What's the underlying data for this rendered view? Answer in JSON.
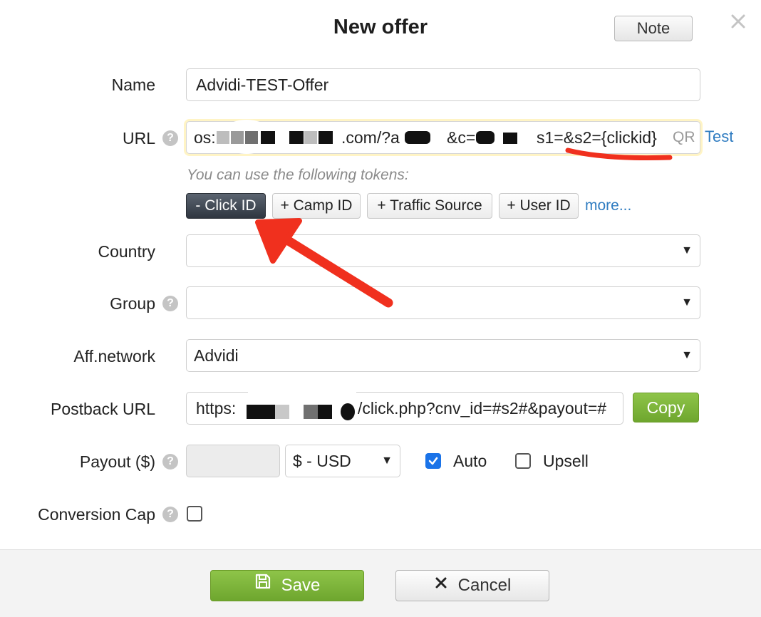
{
  "dialog": {
    "title": "New offer",
    "note_label": "Note",
    "close_icon": "close-icon"
  },
  "form": {
    "name": {
      "label": "Name",
      "value": "Advidi-TEST-Offer"
    },
    "url": {
      "label": "URL",
      "value_prefix": "os:",
      "value_mid1": ".com/?a",
      "value_mid2": "&c=",
      "value_suffix": "s1=&s2={clickid}",
      "qr_label": "QR",
      "test_label": "Test"
    },
    "tokens": {
      "hint": "You can use the following tokens:",
      "items": [
        "-  Click ID",
        "+ Camp ID",
        "+ Traffic Source",
        "+ User ID"
      ],
      "active_index": 0,
      "more_label": "more..."
    },
    "country": {
      "label": "Country",
      "value": ""
    },
    "group": {
      "label": "Group",
      "value": ""
    },
    "aff_network": {
      "label": "Aff.network",
      "value": "Advidi"
    },
    "postback": {
      "label": "Postback URL",
      "value_prefix": "https:",
      "value_suffix": "/click.php?cnv_id=#s2#&payout=#",
      "copy_label": "Copy"
    },
    "payout": {
      "label": "Payout ($)",
      "amount": "",
      "currency": "$ - USD",
      "auto_label": "Auto",
      "auto_checked": true,
      "upsell_label": "Upsell",
      "upsell_checked": false
    },
    "conversion_cap": {
      "label": "Conversion Cap",
      "checked": false
    },
    "help_glyph": "?",
    "caret_glyph": "▼"
  },
  "footer": {
    "save_label": "Save",
    "cancel_label": "Cancel"
  },
  "colors": {
    "accent_green": "#7cb83a",
    "link_blue": "#2f7cc1",
    "checkbox_blue": "#1a73e8",
    "annotation_red": "#f0301e"
  }
}
